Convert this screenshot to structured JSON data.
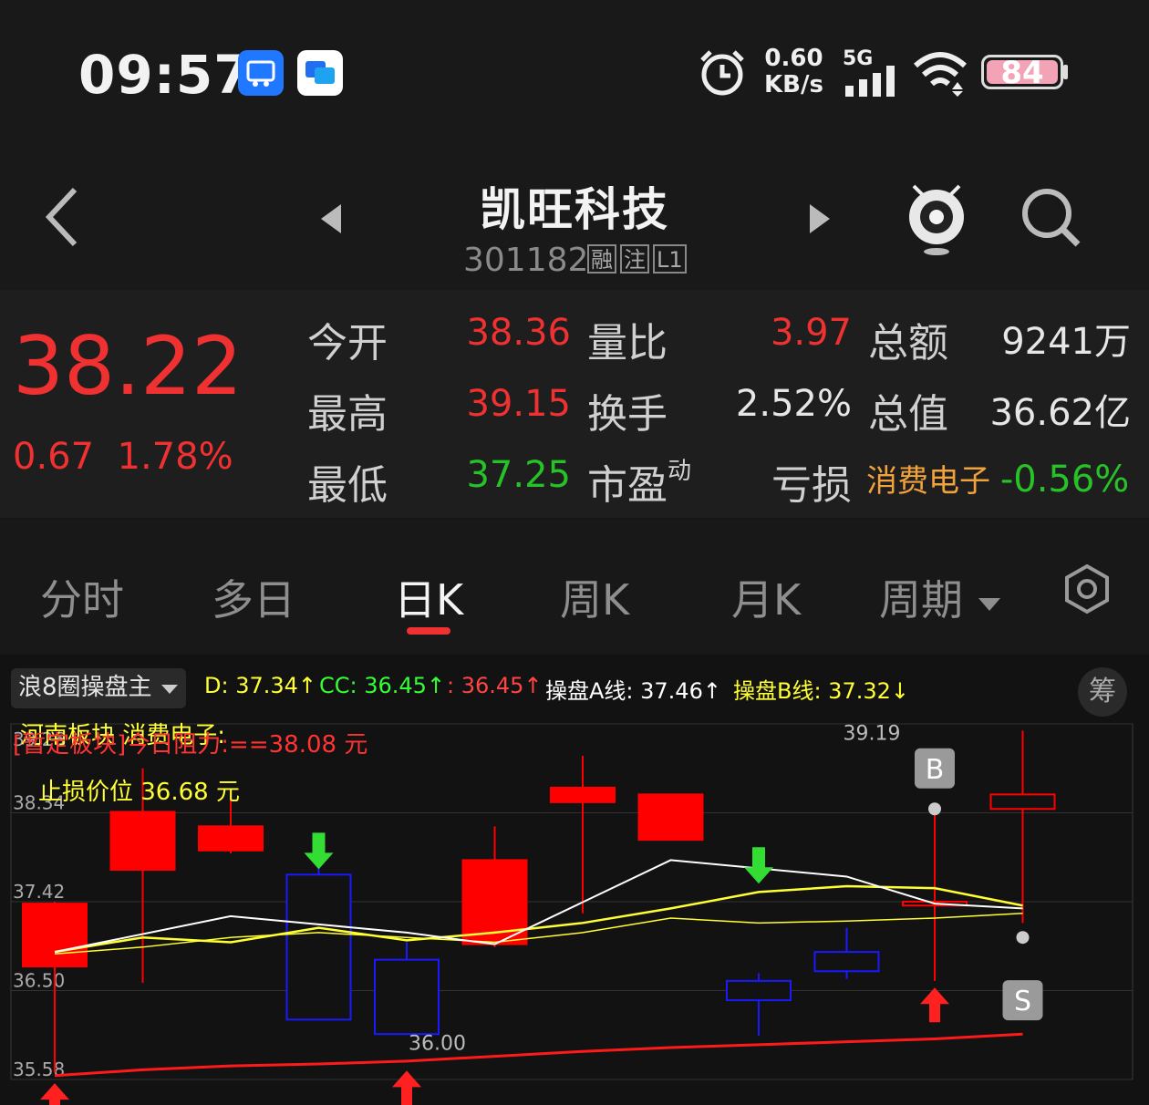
{
  "status_bar": {
    "time": "09:57",
    "net_speed_value": "0.60",
    "net_speed_unit": "KB/s",
    "network": "5G",
    "battery": "84",
    "icons": [
      "screenshot-app-icon",
      "chat-app-icon",
      "alarm-icon",
      "signal-icon",
      "wifi-icon",
      "battery-icon"
    ]
  },
  "header": {
    "name": "凯旺科技",
    "code": "301182",
    "tags": [
      "融",
      "注",
      "L1"
    ]
  },
  "quote": {
    "price": "38.22",
    "change": "0.67",
    "change_pct": "1.78%",
    "labels": {
      "open": "今开",
      "high": "最高",
      "low": "最低",
      "vol_ratio": "量比",
      "turnover": "换手",
      "pe": "市盈",
      "pe_sup": "动",
      "amount": "总额",
      "market_cap": "总值"
    },
    "values": {
      "open": "38.36",
      "high": "39.15",
      "low": "37.25",
      "vol_ratio": "3.97",
      "turnover": "2.52%",
      "pe": "亏损",
      "amount": "9241万",
      "market_cap": "36.62亿"
    },
    "sector": {
      "name": "消费电子",
      "change": "-0.56%"
    }
  },
  "tabs": [
    {
      "label": "分时",
      "active": false
    },
    {
      "label": "多日",
      "active": false
    },
    {
      "label": "日K",
      "active": true
    },
    {
      "label": "周K",
      "active": false
    },
    {
      "label": "月K",
      "active": false
    },
    {
      "label": "周期",
      "active": false
    }
  ],
  "chart": {
    "indicator": "浪8圈操盘主",
    "legend": {
      "d": "D: 37.34↑",
      "cc": "CC: 36.45↑",
      "plain": ": 36.45↑",
      "a": "操盘A线: 37.46↑",
      "b": "操盘B线: 37.32↓"
    },
    "chips_label": "筹",
    "overlay": {
      "sector_line": "河南板块  消费电子:",
      "resistance_line": "[暂定板块]今日阻力:==38.08 元",
      "stop_loss_line": "止损价位   36.68 元"
    },
    "marker_b": "B",
    "marker_s": "S",
    "colors": {
      "up": "#ff0000",
      "down": "#1a1aff",
      "a_line": "#ffffff",
      "b_line": "#ffff33",
      "support": "#ff1a1a",
      "buy_arrow": "#33dd33",
      "sell_arrow": "#ff2020"
    }
  },
  "chart_data": {
    "type": "candlestick",
    "y_ticks": [
      "39.26",
      "38.34",
      "37.42",
      "36.50",
      "35.58"
    ],
    "annotations": {
      "high": "39.19",
      "low": "36.00"
    },
    "ylim": [
      35.58,
      39.26
    ],
    "candles": [
      {
        "open": 36.75,
        "close": 37.4,
        "high": 37.42,
        "low": 35.65,
        "dir": "up"
      },
      {
        "open": 37.75,
        "close": 38.35,
        "high": 38.8,
        "low": 36.58,
        "dir": "up"
      },
      {
        "open": 37.95,
        "close": 38.2,
        "high": 38.55,
        "low": 37.92,
        "dir": "up"
      },
      {
        "open": 37.7,
        "close": 36.2,
        "high": 37.9,
        "low": 36.2,
        "dir": "down"
      },
      {
        "open": 36.82,
        "close": 36.05,
        "high": 37.0,
        "low": 36.05,
        "dir": "down"
      },
      {
        "open": 36.98,
        "close": 37.85,
        "high": 38.2,
        "low": 36.95,
        "dir": "up"
      },
      {
        "open": 38.45,
        "close": 38.6,
        "high": 38.93,
        "low": 37.3,
        "dir": "up"
      },
      {
        "open": 38.06,
        "close": 38.53,
        "high": 38.53,
        "low": 38.06,
        "dir": "up"
      },
      {
        "open": 36.6,
        "close": 36.4,
        "high": 36.68,
        "low": 36.03,
        "dir": "down"
      },
      {
        "open": 36.9,
        "close": 36.7,
        "high": 37.15,
        "low": 36.62,
        "dir": "down"
      },
      {
        "open": 37.42,
        "close": 37.38,
        "high": 38.4,
        "low": 36.6,
        "dir": "up"
      },
      {
        "open": 38.53,
        "close": 38.38,
        "high": 39.19,
        "low": 37.2,
        "dir": "up"
      }
    ],
    "line_white": [
      36.9,
      null,
      37.27,
      null,
      37.1,
      36.98,
      null,
      37.85,
      null,
      37.68,
      37.4,
      37.35
    ],
    "line_yellow": [
      36.9,
      37.05,
      37.0,
      37.15,
      37.02,
      37.1,
      37.2,
      37.35,
      37.52,
      37.58,
      37.56,
      37.38
    ],
    "line_yellow2": [
      36.88,
      36.95,
      37.05,
      37.1,
      37.05,
      37.0,
      37.1,
      37.25,
      37.2,
      37.22,
      37.25,
      37.3
    ],
    "line_support": [
      35.62,
      35.68,
      35.72,
      35.74,
      35.77,
      35.82,
      35.87,
      35.91,
      35.94,
      35.97,
      36.0,
      36.05
    ]
  }
}
